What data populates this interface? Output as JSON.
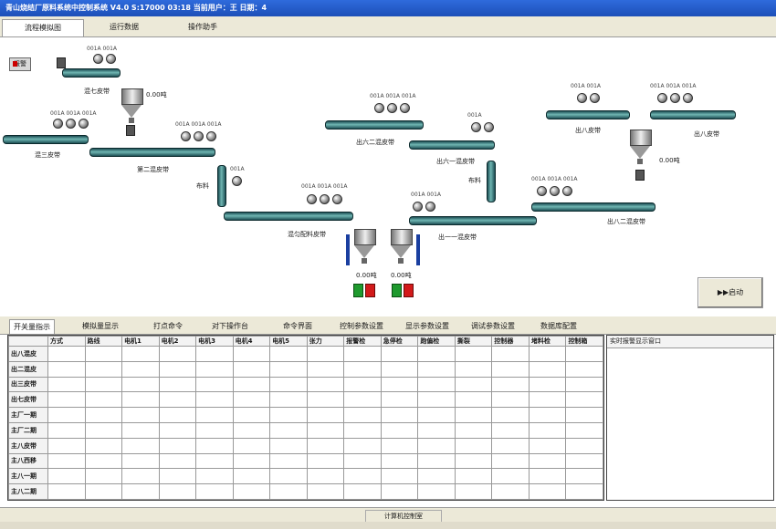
{
  "window": {
    "title": "青山烧结厂原料系统中控制系统 V4.0 S:17000 03:18 当前用户：王 日期：4"
  },
  "tabs": [
    "流程模拟图",
    "运行数据",
    "操作助手"
  ],
  "canvas": {
    "record_button": "报警",
    "conveyors": [
      {
        "label": "混七皮带",
        "motor_label": "001A 001A"
      },
      {
        "label": "混三皮带",
        "motor_label": "001A 001A 001A"
      },
      {
        "label": "第二混皮带",
        "motor_label": "001A 001A 001A"
      },
      {
        "label": "布料",
        "motor_label": "001A"
      },
      {
        "label": "混匀配料皮带",
        "motor_label": "001A 001A 001A"
      },
      {
        "label": "出六二混皮带",
        "motor_label": "001A 001A 001A"
      },
      {
        "label": "出六一混皮带",
        "motor_label": "001A"
      },
      {
        "label": "布料",
        "motor_label": ""
      },
      {
        "label": "出一一混皮带",
        "motor_label": "001A 001A"
      },
      {
        "label": "出八皮带",
        "motor_label": "001A 001A"
      },
      {
        "label": "出八皮带",
        "motor_label": "001A 001A 001A"
      },
      {
        "label": "出八二混皮带",
        "motor_label": "001A 001A 001A"
      }
    ],
    "hopper_values": [
      "0.00吨",
      "0.00吨",
      "0.00吨",
      "0.00吨"
    ],
    "start_button": "▶▶启动"
  },
  "subtabs": [
    "开关量指示",
    "模拟量显示",
    "打点命令",
    "对下操作台",
    "命令界面",
    "控制参数设置",
    "显示参数设置",
    "调试参数设置",
    "数据库配置"
  ],
  "grid": {
    "columns": [
      "",
      "方式",
      "路线",
      "电机1",
      "电机2",
      "电机3",
      "电机4",
      "电机5",
      "张力",
      "报警检",
      "急停检",
      "跑偏检",
      "撕裂",
      "控制器",
      "堵料检",
      "控制箱"
    ],
    "rows": [
      "出八混皮",
      "出二混皮",
      "出三皮带",
      "出七皮带",
      "主厂一期",
      "主厂二期",
      "主八皮带",
      "主八西移",
      "主八一期",
      "主八二期"
    ]
  },
  "alarm_panel": {
    "header": "实时报警显示窗口"
  },
  "status": {
    "text": "计算机控制室"
  }
}
